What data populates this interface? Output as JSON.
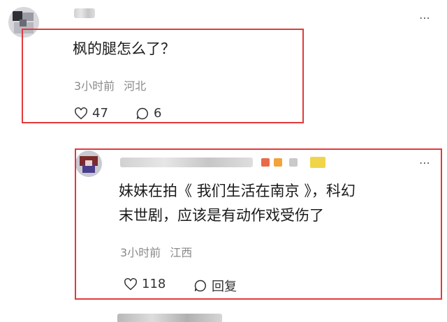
{
  "comment1": {
    "text": "枫的腿怎么了？",
    "time": "3小时前",
    "location": "河北",
    "likes": "47",
    "replies": "6",
    "more": "⋯"
  },
  "comment2": {
    "text_line1": "妹妹在拍《 我们生活在南京 》，科幻",
    "text_line2": "末世剧，应该是有动作戏受伤了",
    "time": "3小时前",
    "location": "江西",
    "likes": "118",
    "reply_label": "回复",
    "more": "⋯"
  },
  "colors": {
    "highlight_box": "#e23a3a",
    "meta_gray": "#8a8a8a"
  }
}
